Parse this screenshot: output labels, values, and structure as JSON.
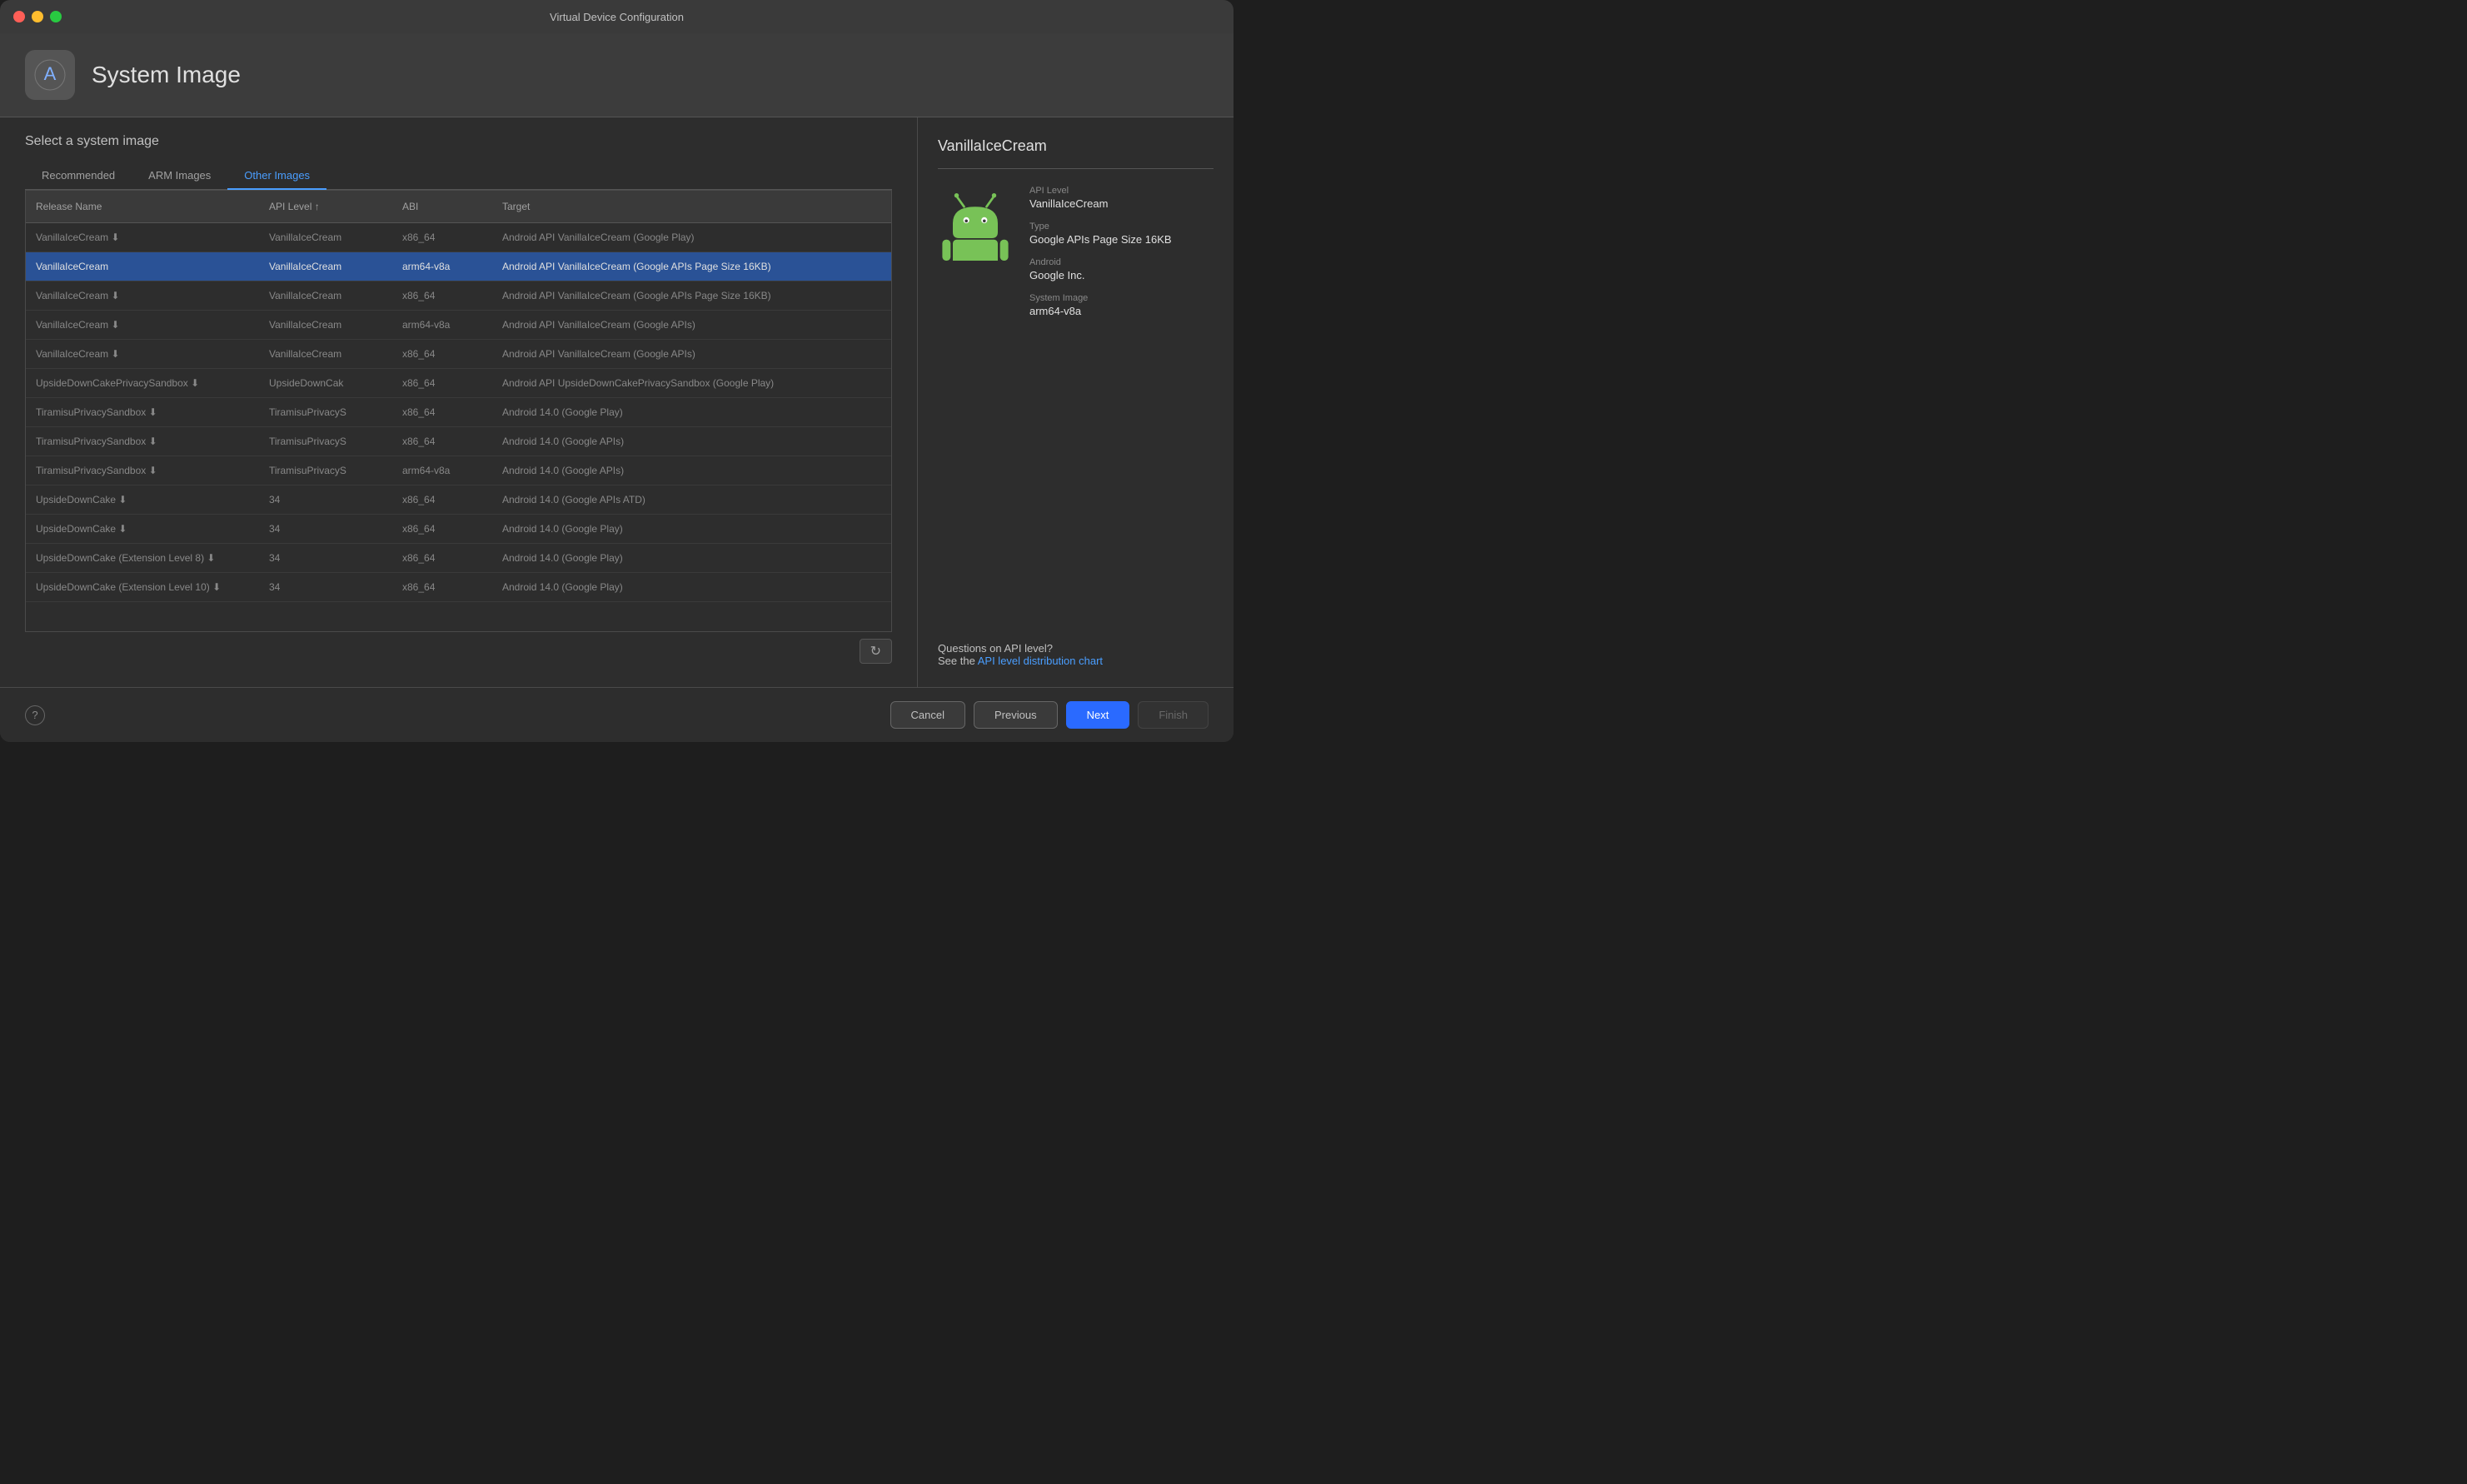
{
  "window": {
    "title": "Virtual Device Configuration"
  },
  "header": {
    "title": "System Image",
    "icon": "🤖"
  },
  "main": {
    "select_label": "Select a system image",
    "tabs": [
      {
        "id": "recommended",
        "label": "Recommended",
        "active": false
      },
      {
        "id": "arm-images",
        "label": "ARM Images",
        "active": false
      },
      {
        "id": "other-images",
        "label": "Other Images",
        "active": true
      }
    ],
    "table": {
      "columns": [
        {
          "id": "release-name",
          "label": "Release Name",
          "sort": null
        },
        {
          "id": "api-level",
          "label": "API Level ↑",
          "sort": "asc"
        },
        {
          "id": "abi",
          "label": "ABI"
        },
        {
          "id": "target",
          "label": "Target"
        }
      ],
      "rows": [
        {
          "release_name": "VanillaIceCream ⬇",
          "api_level": "VanillaIceCream",
          "abi": "x86_64",
          "target": "Android API VanillaIceCream (Google Play)",
          "selected": false
        },
        {
          "release_name": "VanillaIceCream",
          "api_level": "VanillaIceCream",
          "abi": "arm64-v8a",
          "target": "Android API VanillaIceCream (Google APIs Page Size 16KB)",
          "selected": true
        },
        {
          "release_name": "VanillaIceCream ⬇",
          "api_level": "VanillaIceCream",
          "abi": "x86_64",
          "target": "Android API VanillaIceCream (Google APIs Page Size 16KB)",
          "selected": false
        },
        {
          "release_name": "VanillaIceCream ⬇",
          "api_level": "VanillaIceCream",
          "abi": "arm64-v8a",
          "target": "Android API VanillaIceCream (Google APIs)",
          "selected": false
        },
        {
          "release_name": "VanillaIceCream ⬇",
          "api_level": "VanillaIceCream",
          "abi": "x86_64",
          "target": "Android API VanillaIceCream (Google APIs)",
          "selected": false
        },
        {
          "release_name": "UpsideDownCakePrivacySandbox ⬇",
          "api_level": "UpsideDownCak",
          "abi": "x86_64",
          "target": "Android API UpsideDownCakePrivacySandbox (Google Play)",
          "selected": false
        },
        {
          "release_name": "TiramisuPrivacySandbox ⬇",
          "api_level": "TiramisuPrivacyS",
          "abi": "x86_64",
          "target": "Android 14.0 (Google Play)",
          "selected": false
        },
        {
          "release_name": "TiramisuPrivacySandbox ⬇",
          "api_level": "TiramisuPrivacyS",
          "abi": "x86_64",
          "target": "Android 14.0 (Google APIs)",
          "selected": false
        },
        {
          "release_name": "TiramisuPrivacySandbox ⬇",
          "api_level": "TiramisuPrivacyS",
          "abi": "arm64-v8a",
          "target": "Android 14.0 (Google APIs)",
          "selected": false
        },
        {
          "release_name": "UpsideDownCake ⬇",
          "api_level": "34",
          "abi": "x86_64",
          "target": "Android 14.0 (Google APIs ATD)",
          "selected": false
        },
        {
          "release_name": "UpsideDownCake ⬇",
          "api_level": "34",
          "abi": "x86_64",
          "target": "Android 14.0 (Google Play)",
          "selected": false
        },
        {
          "release_name": "UpsideDownCake (Extension Level 8) ⬇",
          "api_level": "34",
          "abi": "x86_64",
          "target": "Android 14.0 (Google Play)",
          "selected": false
        },
        {
          "release_name": "UpsideDownCake (Extension Level 10) ⬇",
          "api_level": "34",
          "abi": "x86_64",
          "target": "Android 14.0 (Google Play)",
          "selected": false
        }
      ]
    },
    "refresh_btn_label": "↻"
  },
  "right_panel": {
    "device_name": "VanillaIceCream",
    "api_level_label": "API Level",
    "api_level_value": "VanillaIceCream",
    "type_label": "Type",
    "type_value": "Google APIs Page Size 16KB",
    "android_label": "Android",
    "android_value": "Google Inc.",
    "system_image_label": "System Image",
    "system_image_value": "arm64-v8a",
    "api_question": "Questions on API level?",
    "api_see": "See the",
    "api_link_text": "API level distribution chart"
  },
  "footer": {
    "help_label": "?",
    "cancel_label": "Cancel",
    "previous_label": "Previous",
    "next_label": "Next",
    "finish_label": "Finish"
  }
}
